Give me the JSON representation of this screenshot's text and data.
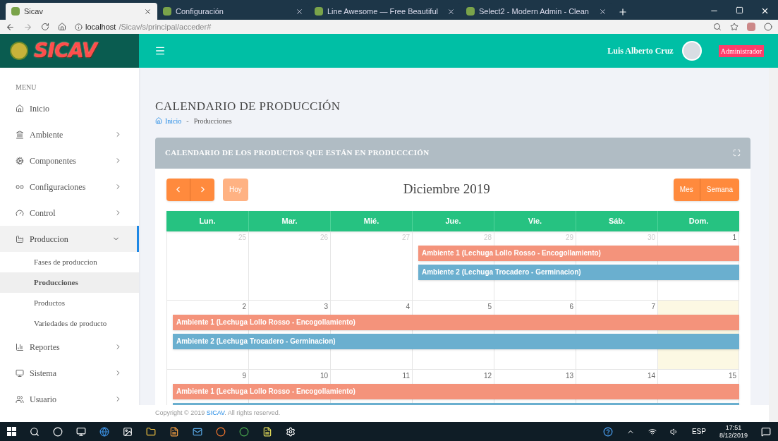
{
  "browser": {
    "tabs": [
      {
        "title": "Sicav",
        "selected": true
      },
      {
        "title": "Configuración",
        "selected": false
      },
      {
        "title": "Line Awesome — Free Beautiful",
        "selected": false
      },
      {
        "title": "Select2 - Modern Admin - Clean",
        "selected": false
      }
    ],
    "url_host": "localhost",
    "url_path": "/Sicav/s/principal/acceder#"
  },
  "header": {
    "brand": "SICAV",
    "user": "Luis Alberto Cruz",
    "role": "Administrador"
  },
  "sidebar": {
    "heading": "MENU",
    "items": [
      {
        "label": "Inicio",
        "expanded": false,
        "has_children": false
      },
      {
        "label": "Ambiente",
        "expanded": false,
        "has_children": true
      },
      {
        "label": "Componentes",
        "expanded": false,
        "has_children": true
      },
      {
        "label": "Configuraciones",
        "expanded": false,
        "has_children": true
      },
      {
        "label": "Control",
        "expanded": false,
        "has_children": true
      },
      {
        "label": "Produccion",
        "expanded": true,
        "has_children": true,
        "children": [
          {
            "label": "Fases de produccion",
            "selected": false
          },
          {
            "label": "Producciones",
            "selected": true
          },
          {
            "label": "Productos",
            "selected": false
          },
          {
            "label": "Variedades de producto",
            "selected": false
          }
        ]
      },
      {
        "label": "Reportes",
        "expanded": false,
        "has_children": true
      },
      {
        "label": "Sistema",
        "expanded": false,
        "has_children": true
      },
      {
        "label": "Usuario",
        "expanded": false,
        "has_children": true
      }
    ]
  },
  "page": {
    "title": "CALENDARIO DE PRODUCCIÓN",
    "breadcrumb": [
      "Inicio",
      "Producciones"
    ],
    "breadcrumb_separator": "-"
  },
  "card": {
    "title": "CALENDARIO DE LOS PRODUCTOS QUE ESTÁN EN PRODUCCCIÓN"
  },
  "calendar": {
    "today_button": {
      "label": "Hoy",
      "disabled": true
    },
    "month": "Diciembre 2019",
    "views": [
      {
        "label": "Mes"
      },
      {
        "label": "Semana"
      }
    ],
    "weekdays": [
      "Lun.",
      "Mar.",
      "Mié.",
      "Jue.",
      "Vie.",
      "Sáb.",
      "Dom."
    ],
    "weeks": [
      {
        "days": [
          {
            "num": "25",
            "other_month": true,
            "today": false
          },
          {
            "num": "26",
            "other_month": true,
            "today": false
          },
          {
            "num": "27",
            "other_month": true,
            "today": false
          },
          {
            "num": "28",
            "other_month": true,
            "today": false,
            "events": [
              {
                "title": "Ambiente 1 (Lechuga Lollo Rosso - Encogollamiento)",
                "color": "#f4937b"
              },
              {
                "title": "Ambiente 2 (Lechuga Trocadero - Germinacion)",
                "color": "#6aafcf"
              }
            ]
          },
          {
            "num": "29",
            "other_month": true,
            "today": false
          },
          {
            "num": "30",
            "other_month": true,
            "today": false
          },
          {
            "num": "1",
            "other_month": false,
            "today": false
          }
        ]
      },
      {
        "days": [
          {
            "num": "2",
            "other_month": false,
            "today": false,
            "events": [
              {
                "title": "Ambiente 1 (Lechuga Lollo Rosso - Encogollamiento)",
                "color": "#f4937b"
              },
              {
                "title": "Ambiente 2 (Lechuga Trocadero - Germinacion)",
                "color": "#6aafcf"
              }
            ]
          },
          {
            "num": "3",
            "other_month": false,
            "today": false
          },
          {
            "num": "4",
            "other_month": false,
            "today": false
          },
          {
            "num": "5",
            "other_month": false,
            "today": false
          },
          {
            "num": "6",
            "other_month": false,
            "today": false
          },
          {
            "num": "7",
            "other_month": false,
            "today": false
          },
          {
            "today": true
          }
        ]
      },
      {
        "days": [
          {
            "num": "9",
            "other_month": false,
            "today": false,
            "events": [
              {
                "title": "Ambiente 1 (Lechuga Lollo Rosso - Encogollamiento)",
                "color": "#f4937b"
              },
              {
                "color": "#6aafcf"
              }
            ]
          },
          {
            "num": "10",
            "other_month": false,
            "today": false
          },
          {
            "num": "11",
            "other_month": false,
            "today": false
          },
          {
            "num": "12",
            "other_month": false,
            "today": false
          },
          {
            "num": "13",
            "other_month": false,
            "today": false
          },
          {
            "num": "14",
            "other_month": false,
            "today": false
          },
          {
            "num": "15",
            "other_month": false,
            "today": false
          }
        ]
      }
    ]
  },
  "footer": {
    "prefix": "Copyright © 2019 ",
    "link": "SICAV",
    "suffix": ". All rights reserved."
  },
  "taskbar": {
    "language": "ESP",
    "time": "17:51",
    "date": "8/12/2019"
  }
}
